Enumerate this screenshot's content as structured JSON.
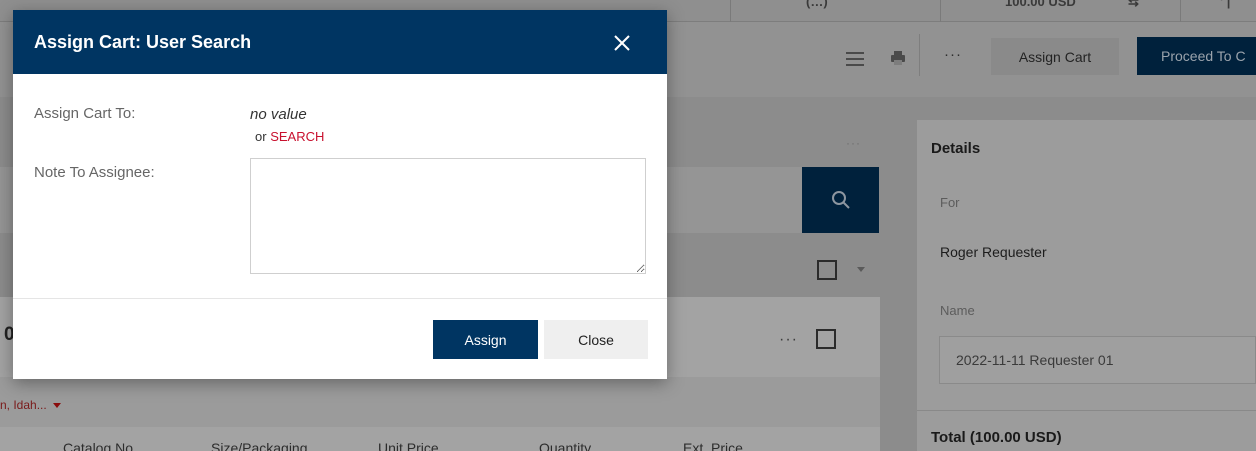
{
  "page": {
    "topbar": {
      "left_text": "(…)",
      "right_text": "100.00 USD",
      "cart_glyph": "⇆",
      "far_text": "' |"
    },
    "toolbar": {
      "menu_icon": "hamburger-icon",
      "print_icon": "printer-icon",
      "more_label": "···",
      "assign_cart_label": "Assign Cart",
      "proceed_label": "Proceed To C"
    },
    "left": {
      "more_dots": "···",
      "card_digit": "0",
      "card_dots": "···",
      "location_text": "n, Idah...",
      "columns": [
        "Catalog No.",
        "Size/Packaging",
        "Unit Price",
        "Quantity",
        "Ext. Price"
      ]
    },
    "details": {
      "title": "Details",
      "for_label": "For",
      "for_value": "Roger Requester",
      "name_label": "Name",
      "name_value": "2022-11-11 Requester 01",
      "total": "Total (100.00 USD)"
    }
  },
  "modal": {
    "title": "Assign Cart: User Search",
    "assign_to_label": "Assign Cart To:",
    "assign_to_value": "no value",
    "or_text": "or",
    "search_link": "SEARCH",
    "note_label": "Note To Assignee:",
    "note_value": "",
    "assign_button": "Assign",
    "close_button": "Close"
  },
  "colors": {
    "modal_header": "#003562",
    "primary_button": "#003562",
    "search_link": "#c8102e",
    "overlay_dim": "#8c8c8c"
  }
}
